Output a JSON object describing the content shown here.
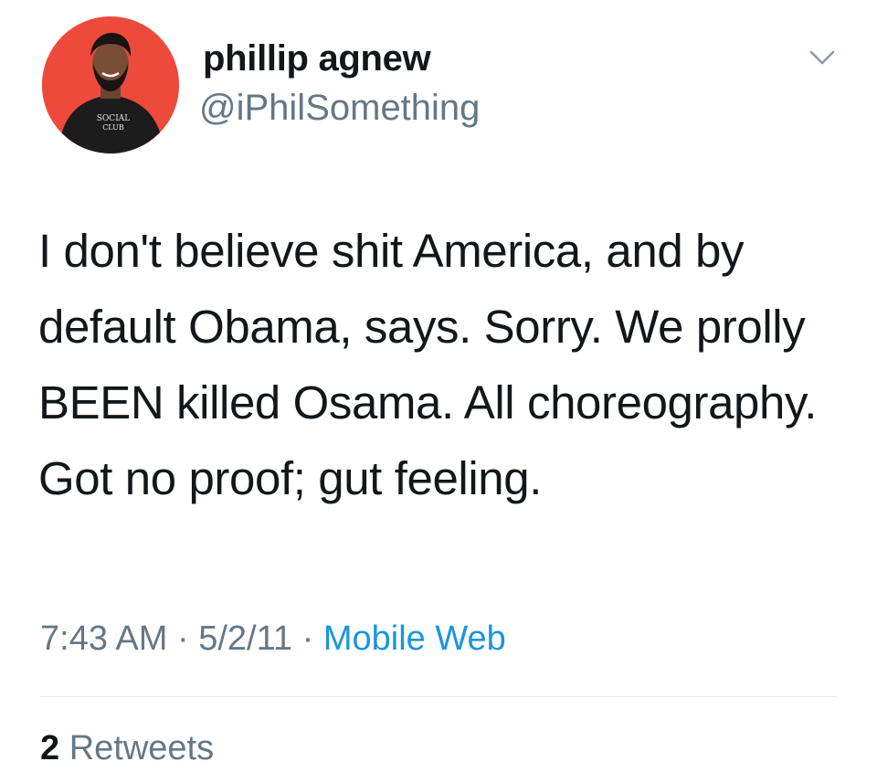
{
  "tweet": {
    "author": {
      "name": "phillip agnew",
      "handle": "@iPhilSomething",
      "avatar_bg": "#ee4a3c",
      "avatar_shirt_text": [
        "SOCIAL",
        "CLUB"
      ]
    },
    "text": "I don't believe shit America, and by default Obama, says. Sorry. We prolly BEEN killed Osama. All choreography. Got no proof; gut feeling.",
    "time": "7:43 AM",
    "date": "5/2/11",
    "separator": "·",
    "source": "Mobile Web",
    "retweets": {
      "count": "2",
      "label": "Retweets"
    },
    "menu_icon": "chevron-down-icon"
  },
  "colors": {
    "text_primary": "#14171a",
    "text_secondary": "#657786",
    "link": "#1b95e0",
    "divider": "#e1e8ed"
  }
}
